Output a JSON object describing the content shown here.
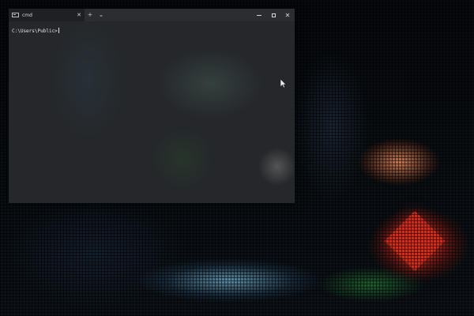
{
  "terminal": {
    "tab_title": "cmd",
    "tab_close": "✕",
    "new_tab_glyph": "+",
    "dropdown_glyph": "⌄",
    "prompt": "C:\\Users\\Public>"
  },
  "window_controls": {
    "close_glyph": "✕"
  },
  "icons": [
    "terminal-icon",
    "close-icon",
    "plus-icon",
    "chevron-down-icon",
    "minimize-icon",
    "maximize-icon",
    "mouse-pointer-icon"
  ],
  "colors": {
    "titlebar": "#2b2d30",
    "active_tab": "#1f2023",
    "console_bg": "#26292c",
    "console_text": "#e6e6e6"
  }
}
